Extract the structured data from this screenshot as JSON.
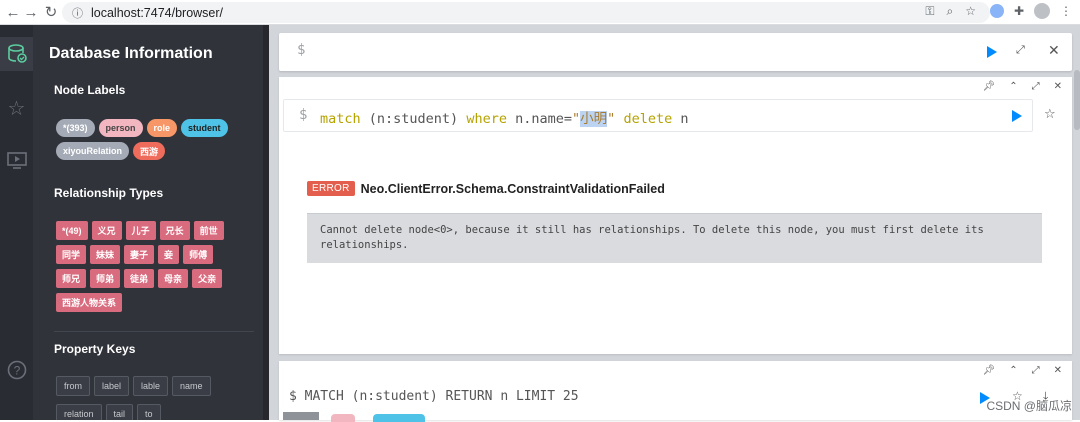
{
  "browser": {
    "url": "localhost:7474/browser/",
    "back": "←",
    "forward": "→",
    "reload": "↻",
    "info": "ⓘ"
  },
  "sidebar": {
    "title": "Database Information",
    "node_labels_title": "Node Labels",
    "node_labels": [
      {
        "label": "*(393)",
        "color": "#a5abb6",
        "text_color": "#ffffff"
      },
      {
        "label": "person",
        "color": "#f2b6c1",
        "text_color": "#444444"
      },
      {
        "label": "role",
        "color": "#f79767",
        "text_color": "#ffffff"
      },
      {
        "label": "student",
        "color": "#4fc3e7",
        "text_color": "#222222"
      },
      {
        "label": "xiyouRelation",
        "color": "#a5abb6",
        "text_color": "#ffffff"
      },
      {
        "label": "西游",
        "color": "#ef6b5b",
        "text_color": "#ffffff"
      }
    ],
    "relationship_types_title": "Relationship Types",
    "relationship_types": [
      "*(49)",
      "义兄",
      "儿子",
      "兄长",
      "前世",
      "同学",
      "妹妹",
      "妻子",
      "妾",
      "师傅",
      "师兄",
      "师弟",
      "徒弟",
      "母亲",
      "父亲",
      "西游人物关系"
    ],
    "relationship_color": "#d96b7e",
    "property_keys_title": "Property Keys",
    "property_keys": [
      "from",
      "label",
      "lable",
      "name",
      "relation",
      "tail",
      "to"
    ]
  },
  "editor": {
    "prompt": "$"
  },
  "frame1": {
    "prompt": "$",
    "query_keyword_match": "match",
    "query_ident": "(n:student)",
    "query_keyword_where": "where",
    "query_condition": "n.name=",
    "query_string_open": "\"",
    "query_string_sel": "小明",
    "query_string_close": "\"",
    "query_keyword_delete": "delete",
    "query_tail": "n",
    "error_badge": "ERROR",
    "error_code": "Neo.ClientError.Schema.ConstraintValidationFailed",
    "error_message": "Cannot delete node<0>, because it still has relationships. To delete this node, you must first delete its relationships."
  },
  "frame2": {
    "query": "$ MATCH (n:student) RETURN n LIMIT 25"
  },
  "watermark": "CSDN @脑瓜凉"
}
